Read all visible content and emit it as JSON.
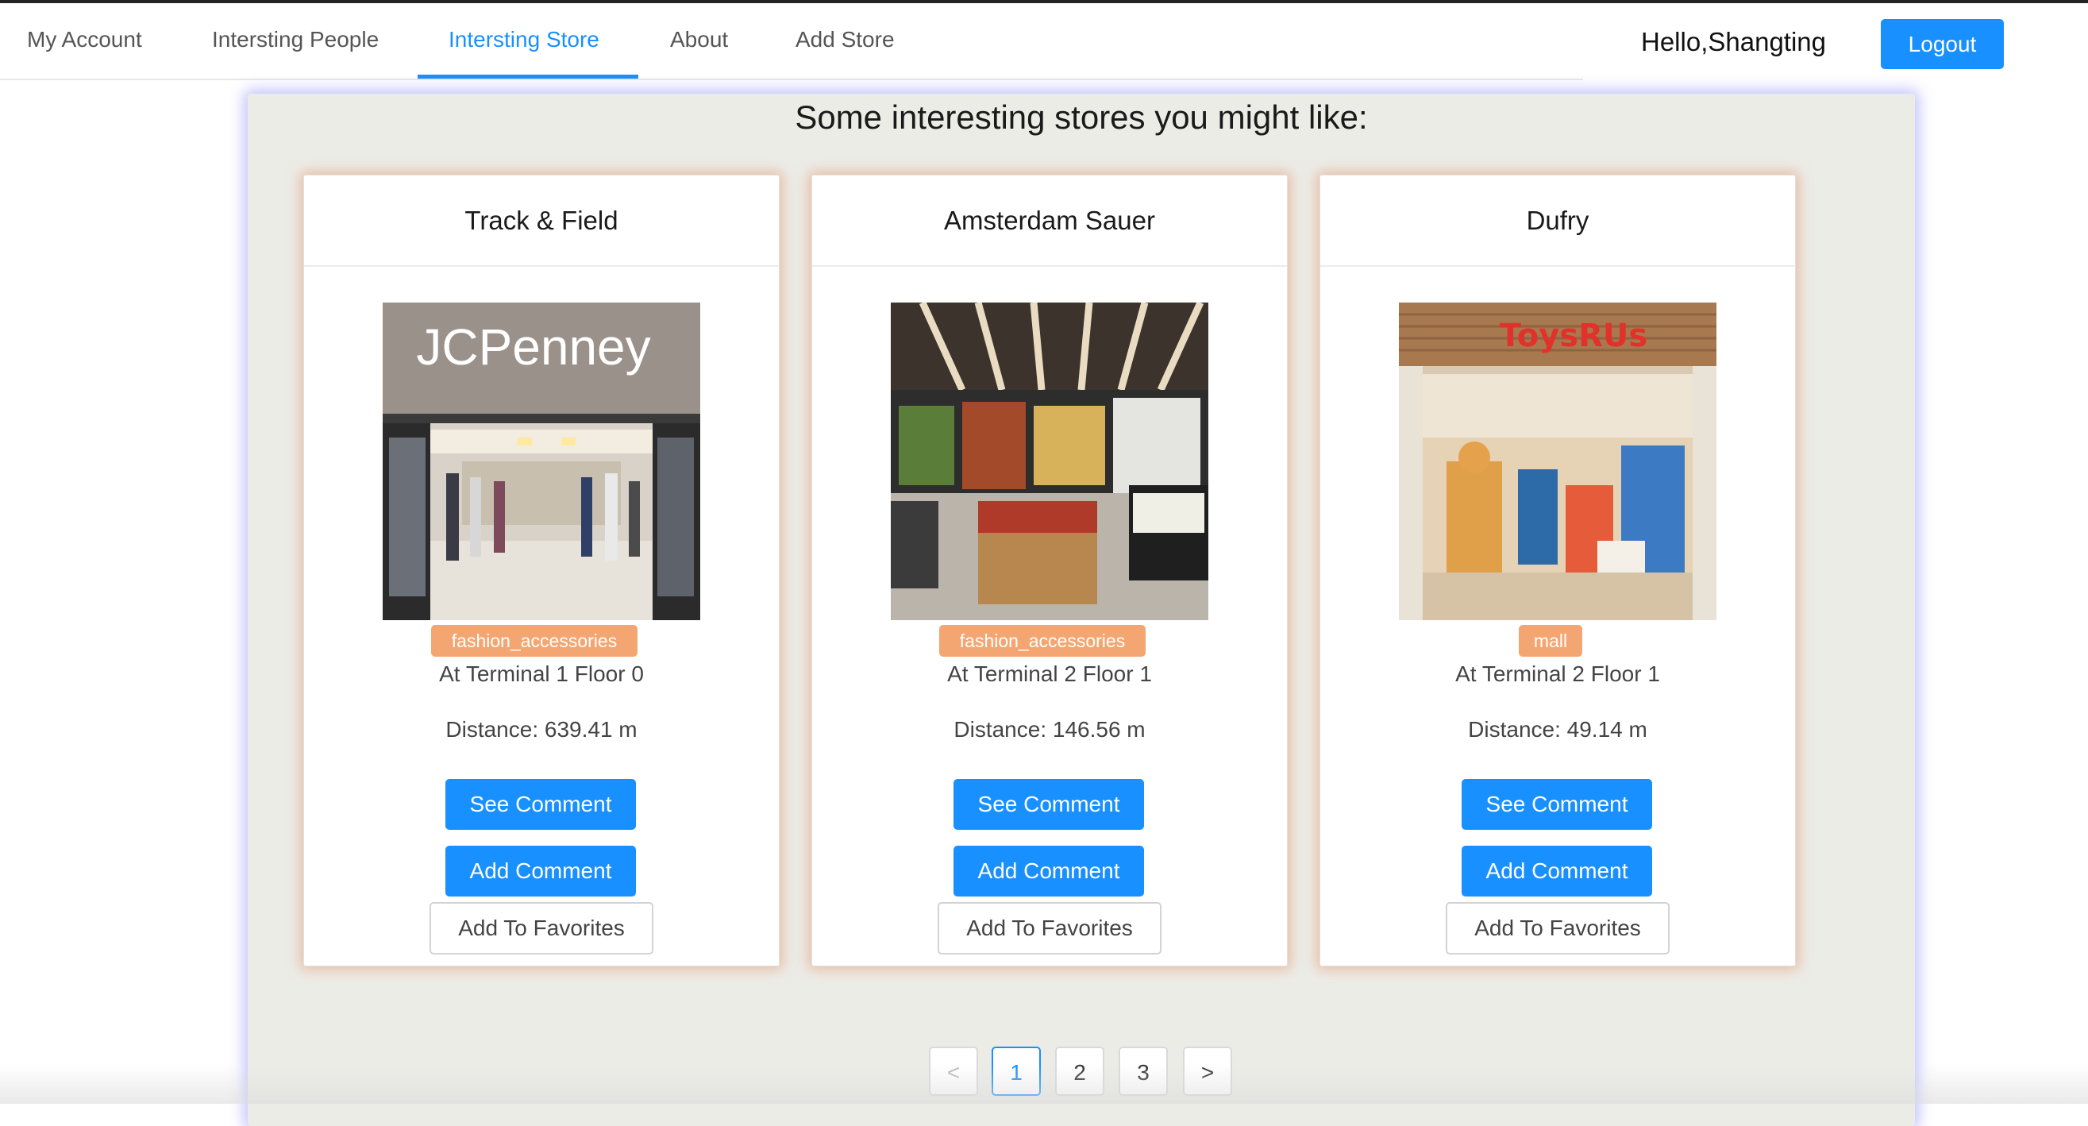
{
  "nav": {
    "items": [
      {
        "label": "My Account"
      },
      {
        "label": "Intersting People"
      },
      {
        "label": "Intersting Store"
      },
      {
        "label": "About"
      },
      {
        "label": "Add Store"
      }
    ],
    "active_index": 2
  },
  "header": {
    "greeting": "Hello,Shangting",
    "logout_label": "Logout"
  },
  "main": {
    "title": "Some interesting stores you might like:",
    "stores": [
      {
        "name": "Track & Field",
        "image_sign": "JCPenney",
        "category": "fashion_accessories",
        "location": "At Terminal 1 Floor 0",
        "distance": "Distance: 639.41 m",
        "see_comment_label": "See Comment",
        "add_comment_label": "Add Comment",
        "favorite_label": "Add To Favorites"
      },
      {
        "name": "Amsterdam Sauer",
        "category": "fashion_accessories",
        "location": "At Terminal 2 Floor 1",
        "distance": "Distance: 146.56 m",
        "see_comment_label": "See Comment",
        "add_comment_label": "Add Comment",
        "favorite_label": "Add To Favorites"
      },
      {
        "name": "Dufry",
        "image_sign": "ToysRUs",
        "category": "mall",
        "location": "At Terminal 2 Floor 1",
        "distance": "Distance: 49.14 m",
        "see_comment_label": "See Comment",
        "add_comment_label": "Add Comment",
        "favorite_label": "Add To Favorites"
      }
    ]
  },
  "pagination": {
    "prev_icon": "chevron-left-icon",
    "next_icon": "chevron-right-icon",
    "prev_glyph": "<",
    "next_glyph": ">",
    "pages": [
      "1",
      "2",
      "3"
    ],
    "current": "1"
  },
  "colors": {
    "accent": "#1890ff",
    "tag": "#f4a672",
    "panel_bg": "#ecece7",
    "card_glow": "#e2966e",
    "panel_glow": "#7878ff"
  }
}
